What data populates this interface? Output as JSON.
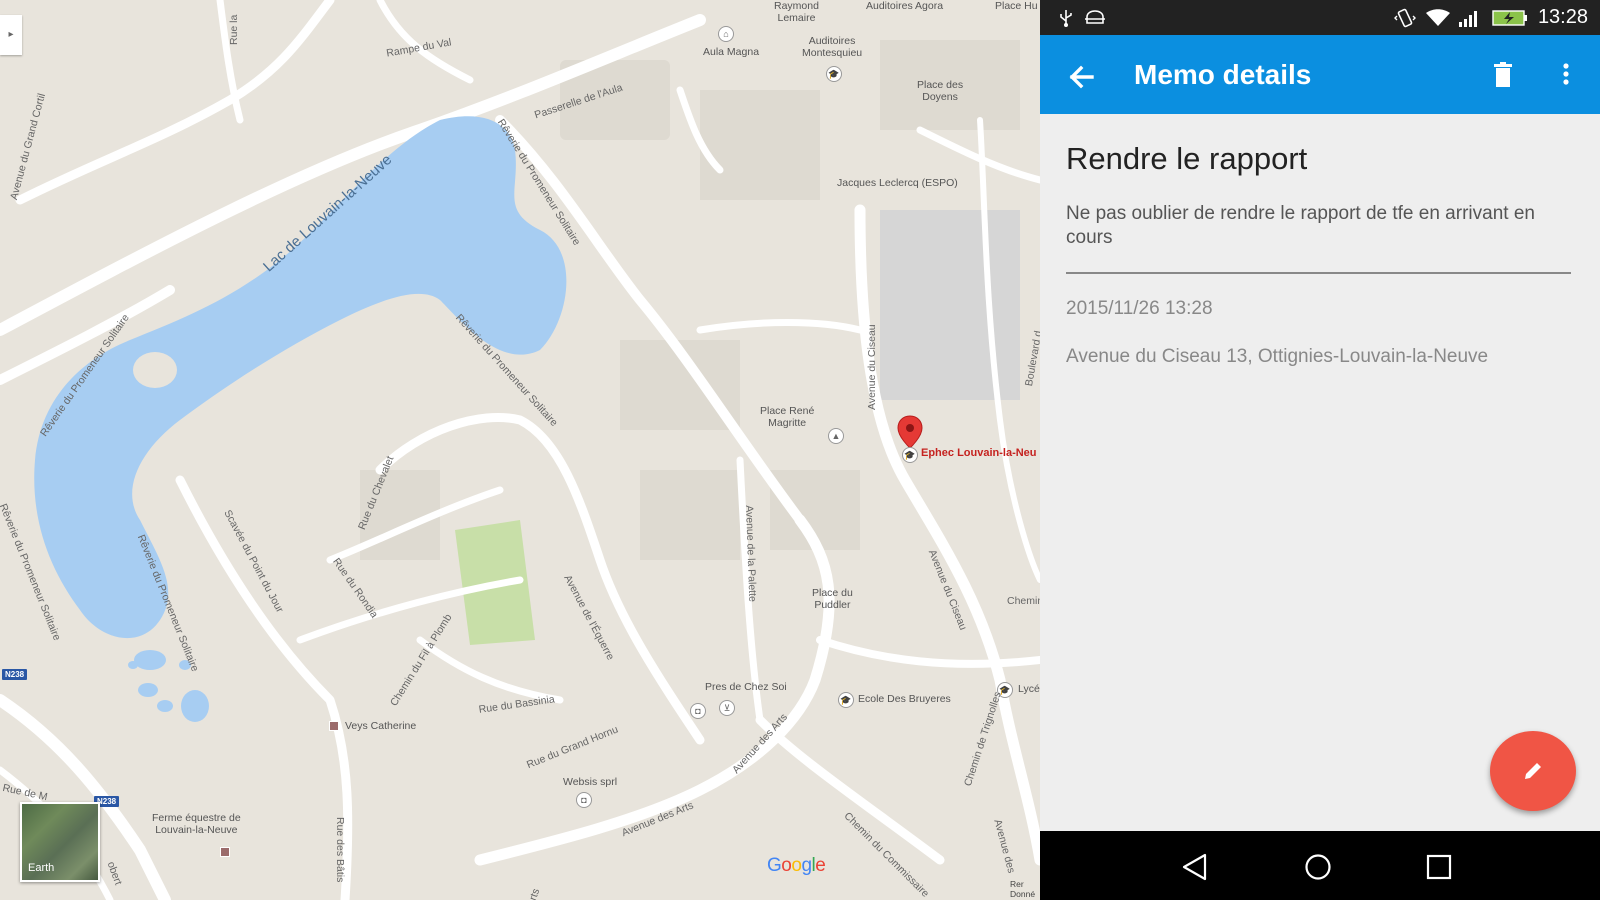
{
  "map": {
    "lake_label": "Lac de Louvain-la-Neuve",
    "labels": {
      "raymond": "Raymond\nLemaire",
      "auditoires_agora": "Auditoires Agora",
      "place_hu": "Place Hu",
      "rue_la": "Rue la",
      "rampe_du_val": "Rampe du Val",
      "aula_magna": "Aula Magna",
      "auditoires_montesquieu": "Auditoires\nMontesquieu",
      "place_des_doyens": "Place des\nDoyens",
      "passerelle": "Passerelle de l'Aula",
      "avenue_grand_cortil": "Avenue du Grand Cortil",
      "reverie_top": "Rêverie du Promeneur Solitaire",
      "jacques_leclercq": "Jacques Leclercq (ESPO)",
      "reverie_left": "Rêverie du Promeneur Solitaire",
      "reverie_mid": "Rêverie du Promeneur Solitaire",
      "avenue_ciseau_v": "Avenue du Ciseau",
      "boulevard": "Boulevard d",
      "place_rene_magritte": "Place René\nMagritte",
      "rue_chevalet": "Rue du Chevalet",
      "scavee": "Scavée du Point du Jour",
      "reverie_far_left": "Rêverie du Promeneur Solitaire",
      "reverie_lake_bottom": "Rêverie du Promeneur Solitaire",
      "rue_rondia": "Rue du Rondia",
      "avenue_equerre": "Avenue de l'Équerre",
      "avenue_palette": "Avenue de la Palette",
      "place_du_puddler": "Place du\nPuddler",
      "avenue_ciseau_d": "Avenue du Ciseau",
      "chemin_right": "Chemin",
      "chemin_fil_plomb": "Chemin du Fil à Plomb",
      "rue_bassinia": "Rue du Bassinia",
      "pres_de_chez_soi": "Pres de Chez Soi",
      "ecole_bruyeres": "Ecole Des Bruyeres",
      "lycee": "Lycée",
      "veys_catherine": "Veys Catherine",
      "rue_grand_hornu": "Rue du Grand Hornu",
      "avenue_des_arts1": "Avenue des Arts",
      "avenue_des_arts2": "Avenue des Arts",
      "websis": "Websis sprl",
      "ferme": "Ferme équestre de\nLouvain-la-Neuve",
      "rue_de_m": "Rue de M",
      "rue_des_bats": "Rue des Bâtis",
      "chemin_commissaire": "Chemin du Commissaire",
      "chemin_trigonolles": "Chemin de Trignolles",
      "avenue_des_bottom": "Avenue des",
      "robert": "obert",
      "arts_bottom": "rts"
    },
    "route_n238_a": "N238",
    "route_n238_b": "N238",
    "ephec_label": "Ephec Louvain-la-Neu",
    "google_logo": "Google",
    "earth_label": "Earth",
    "attribution": "Rer\nDonné"
  },
  "status_bar": {
    "time": "13:28"
  },
  "app_bar": {
    "title": "Memo details",
    "back_icon": "arrow-back-icon",
    "delete_icon": "trash-icon",
    "overflow_icon": "more-vert-icon"
  },
  "memo": {
    "title": "Rendre le rapport",
    "body": "Ne pas oublier de rendre le rapport de tfe en arrivant en cours",
    "date": "2015/11/26 13:28",
    "address": "Avenue du Ciseau 13, Ottignies-Louvain-la-Neuve"
  },
  "fab": {
    "icon": "edit-pencil-icon"
  },
  "nav": {
    "back": "nav-back-icon",
    "home": "nav-home-icon",
    "recents": "nav-recents-icon"
  },
  "colors": {
    "app_bar": "#0b8fe0",
    "fab": "#f05545",
    "lake": "#a7cdf2",
    "map_bg": "#e8e4dc"
  }
}
